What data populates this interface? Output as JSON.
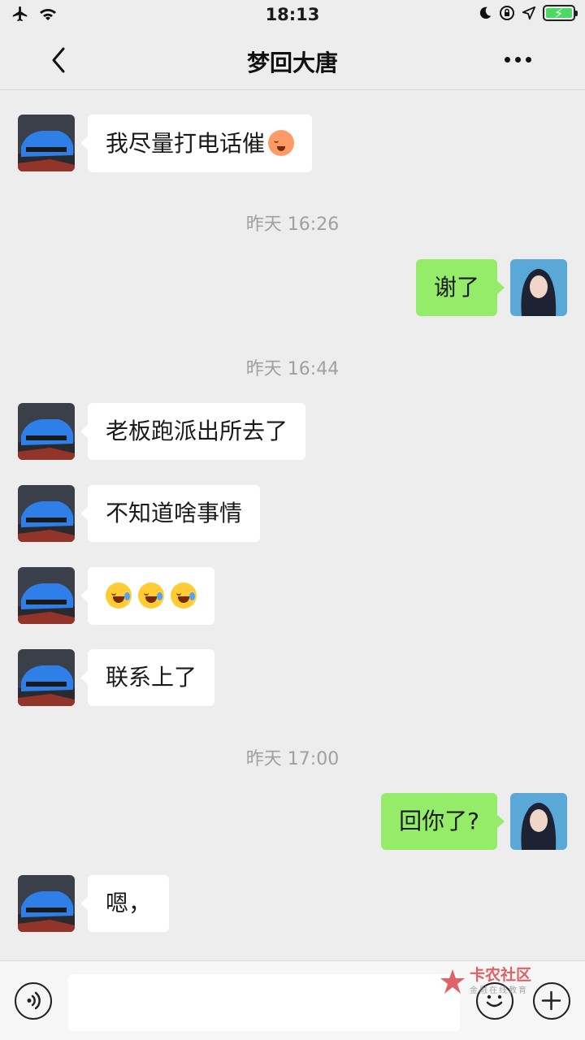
{
  "status": {
    "time": "18:13"
  },
  "nav": {
    "title": "梦回大唐"
  },
  "messages": [
    {
      "side": "left",
      "text": "我尽量打电话催",
      "emoji": "flushed"
    },
    {
      "timestamp": "昨天 16:26"
    },
    {
      "side": "right",
      "text": "谢了"
    },
    {
      "timestamp": "昨天 16:44"
    },
    {
      "side": "left",
      "text": "老板跑派出所去了"
    },
    {
      "side": "left",
      "text": "不知道啥事情"
    },
    {
      "side": "left",
      "text": "",
      "emoji": "joy-x3"
    },
    {
      "side": "left",
      "text": "联系上了"
    },
    {
      "timestamp": "昨天 17:00"
    },
    {
      "side": "right",
      "text": "回你了?"
    },
    {
      "side": "left",
      "text": "嗯，"
    }
  ],
  "watermark": {
    "brand": "卡农社区",
    "sub": "金融在线教育"
  },
  "colors": {
    "sent_bubble": "#95ec69",
    "received_bubble": "#ffffff",
    "background": "#ededed"
  }
}
